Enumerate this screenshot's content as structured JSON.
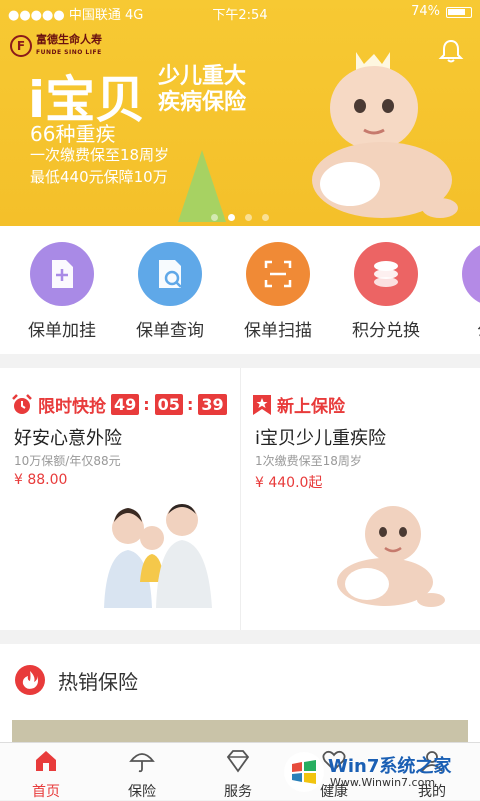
{
  "status_bar": {
    "carrier": "●●●●● 中国联通 4G",
    "time": "下午2:54",
    "battery": "74%"
  },
  "banner": {
    "brand_cn": "富德生命人寿",
    "brand_en": "FUNDE SINO LIFE",
    "title": "i宝贝",
    "subtitle_line1": "少儿重大",
    "subtitle_line2": "疾病保险",
    "line1": "66种重疾",
    "line2": "一次缴费保至18周岁",
    "line3": "最低440元保障10万",
    "slide_count": 4,
    "active_slide": 1
  },
  "actions": [
    {
      "label": "保单加挂",
      "icon": "add-document-icon",
      "color": "#a98ae6"
    },
    {
      "label": "保单查询",
      "icon": "search-document-icon",
      "color": "#5fa8e8"
    },
    {
      "label": "保单扫描",
      "icon": "scan-icon",
      "color": "#f08a36"
    },
    {
      "label": "积分兑换",
      "icon": "coins-icon",
      "color": "#ec6464"
    },
    {
      "label": "公司",
      "icon": "company-icon",
      "color": "#b48ae6"
    }
  ],
  "promos": {
    "left": {
      "tag": "限时快抢",
      "countdown": [
        "49",
        "05",
        "39"
      ],
      "name": "好安心意外险",
      "desc": "10万保额/年仅88元",
      "price": "¥ 88.00"
    },
    "right": {
      "tag": "新上保险",
      "name": "i宝贝少儿重疾险",
      "desc": "1次缴费保至18周岁",
      "price": "¥ 440.0起"
    }
  },
  "hot": {
    "title": "热销保险"
  },
  "tabs": [
    {
      "label": "首页",
      "icon": "home-icon"
    },
    {
      "label": "保险",
      "icon": "umbrella-icon"
    },
    {
      "label": "服务",
      "icon": "diamond-icon"
    },
    {
      "label": "健康",
      "icon": "heart-icon"
    },
    {
      "label": "我的",
      "icon": "user-icon"
    }
  ],
  "watermark": {
    "text": "Win7系统之家",
    "url": "Www.Winwin7.com"
  },
  "colors": {
    "accent": "#e83b3b",
    "banner": "#f4c02a"
  }
}
